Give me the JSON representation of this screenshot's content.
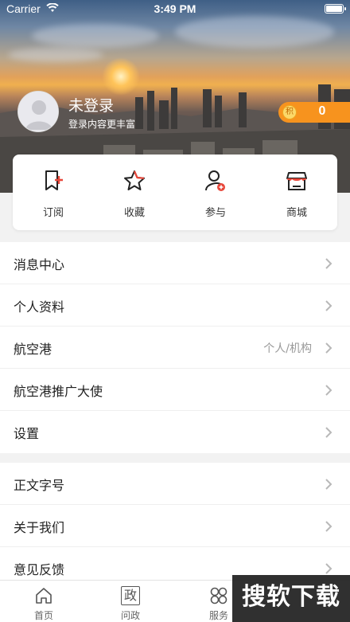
{
  "status_bar": {
    "carrier": "Carrier",
    "time": "3:49 PM"
  },
  "profile": {
    "name": "未登录",
    "subtitle": "登录内容更丰富",
    "points_badge": "积",
    "points_value": "0"
  },
  "quick_actions": [
    {
      "label": "订阅",
      "icon": "subscribe-icon"
    },
    {
      "label": "收藏",
      "icon": "star-icon"
    },
    {
      "label": "参与",
      "icon": "user-add-icon"
    },
    {
      "label": "商城",
      "icon": "store-icon"
    }
  ],
  "menu_group_1": [
    {
      "title": "消息中心",
      "extra": ""
    },
    {
      "title": "个人资料",
      "extra": ""
    },
    {
      "title": "航空港",
      "extra": "个人/机构"
    },
    {
      "title": "航空港推广大使",
      "extra": ""
    },
    {
      "title": "设置",
      "extra": ""
    }
  ],
  "menu_group_2": [
    {
      "title": "正文字号",
      "extra": ""
    },
    {
      "title": "关于我们",
      "extra": ""
    },
    {
      "title": "意见反馈",
      "extra": ""
    }
  ],
  "tab_bar": [
    {
      "label": "首页",
      "icon": "home-icon"
    },
    {
      "label": "问政",
      "icon": "gov-icon",
      "glyph": "政"
    },
    {
      "label": "服务",
      "icon": "grid-icon"
    }
  ],
  "watermark": "搜软下载",
  "colors": {
    "accent": "#f7931e",
    "icon_red": "#e8473a",
    "text": "#222222",
    "muted": "#999999"
  }
}
